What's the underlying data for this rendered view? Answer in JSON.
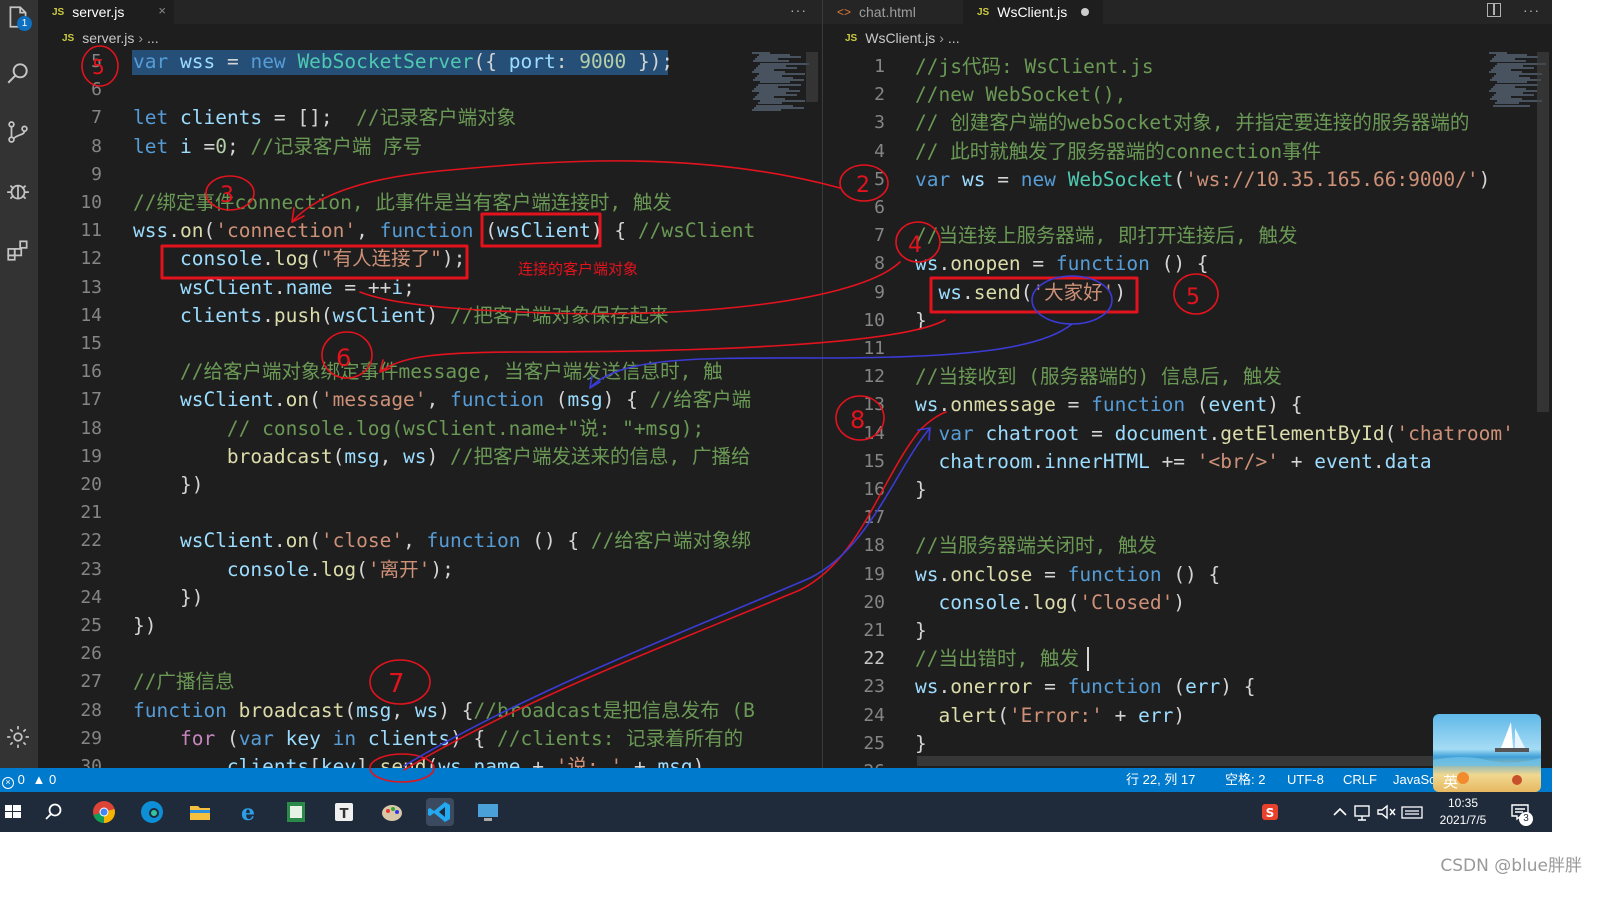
{
  "left_editor": {
    "tab_label": "server.js",
    "tab_close": "×",
    "breadcrumb": [
      "server.js",
      "..."
    ],
    "more": "···",
    "lines": [
      {
        "n": "5",
        "tokens": [
          [
            "k",
            "var"
          ],
          [
            "p",
            " "
          ],
          [
            "v",
            "wss"
          ],
          [
            "p",
            " = "
          ],
          [
            "k",
            "new"
          ],
          [
            "p",
            " "
          ],
          [
            "t",
            "WebSocketServer"
          ],
          [
            "p",
            "({ "
          ],
          [
            "v",
            "port"
          ],
          [
            "p",
            ": "
          ],
          [
            "n",
            "9000"
          ],
          [
            "p",
            " });"
          ]
        ]
      },
      {
        "n": "6",
        "tokens": []
      },
      {
        "n": "7",
        "tokens": [
          [
            "k",
            "let"
          ],
          [
            "p",
            " "
          ],
          [
            "v",
            "clients"
          ],
          [
            "p",
            " = [];  "
          ],
          [
            "c",
            "//记录客户端对象"
          ]
        ]
      },
      {
        "n": "8",
        "tokens": [
          [
            "k",
            "let"
          ],
          [
            "p",
            " "
          ],
          [
            "v",
            "i"
          ],
          [
            "p",
            " ="
          ],
          [
            "n",
            "0"
          ],
          [
            "p",
            "; "
          ],
          [
            "c",
            "//记录客户端 序号"
          ]
        ]
      },
      {
        "n": "9",
        "tokens": []
      },
      {
        "n": "10",
        "tokens": [
          [
            "c",
            "//绑定事件connection, 此事件是当有客户端连接时, 触发"
          ]
        ]
      },
      {
        "n": "11",
        "tokens": [
          [
            "v",
            "wss"
          ],
          [
            "p",
            "."
          ],
          [
            "f",
            "on"
          ],
          [
            "p",
            "("
          ],
          [
            "s",
            "'connection'"
          ],
          [
            "p",
            ", "
          ],
          [
            "k",
            "function"
          ],
          [
            "p",
            " ("
          ],
          [
            "v",
            "wsClient"
          ],
          [
            "p",
            ") { "
          ],
          [
            "c",
            "//wsClient"
          ]
        ]
      },
      {
        "n": "12",
        "tokens": [
          [
            "p",
            "    "
          ],
          [
            "v",
            "console"
          ],
          [
            "p",
            "."
          ],
          [
            "f",
            "log"
          ],
          [
            "p",
            "("
          ],
          [
            "s",
            "\"有人连接了\""
          ],
          [
            "p",
            ");"
          ]
        ]
      },
      {
        "n": "13",
        "tokens": [
          [
            "p",
            "    "
          ],
          [
            "v",
            "wsClient"
          ],
          [
            "p",
            "."
          ],
          [
            "v",
            "name"
          ],
          [
            "p",
            " = ++"
          ],
          [
            "v",
            "i"
          ],
          [
            "p",
            ";"
          ]
        ]
      },
      {
        "n": "14",
        "tokens": [
          [
            "p",
            "    "
          ],
          [
            "v",
            "clients"
          ],
          [
            "p",
            "."
          ],
          [
            "f",
            "push"
          ],
          [
            "p",
            "("
          ],
          [
            "v",
            "wsClient"
          ],
          [
            "p",
            ") "
          ],
          [
            "c",
            "//把客户端对象保存起来"
          ]
        ]
      },
      {
        "n": "15",
        "tokens": []
      },
      {
        "n": "16",
        "tokens": [
          [
            "p",
            "    "
          ],
          [
            "c",
            "//给客户端对象绑定事件message, 当客户端发送信息时, 触"
          ]
        ]
      },
      {
        "n": "17",
        "tokens": [
          [
            "p",
            "    "
          ],
          [
            "v",
            "wsClient"
          ],
          [
            "p",
            "."
          ],
          [
            "f",
            "on"
          ],
          [
            "p",
            "("
          ],
          [
            "s",
            "'message'"
          ],
          [
            "p",
            ", "
          ],
          [
            "k",
            "function"
          ],
          [
            "p",
            " ("
          ],
          [
            "v",
            "msg"
          ],
          [
            "p",
            ") { "
          ],
          [
            "c",
            "//给客户端"
          ]
        ]
      },
      {
        "n": "18",
        "tokens": [
          [
            "p",
            "        "
          ],
          [
            "c",
            "// console.log(wsClient.name+\"说: \"+msg);"
          ]
        ]
      },
      {
        "n": "19",
        "tokens": [
          [
            "p",
            "        "
          ],
          [
            "f",
            "broadcast"
          ],
          [
            "p",
            "("
          ],
          [
            "v",
            "msg"
          ],
          [
            "p",
            ", "
          ],
          [
            "v",
            "ws"
          ],
          [
            "p",
            ") "
          ],
          [
            "c",
            "//把客户端发送来的信息, 广播给"
          ]
        ]
      },
      {
        "n": "20",
        "tokens": [
          [
            "p",
            "    })"
          ]
        ]
      },
      {
        "n": "21",
        "tokens": []
      },
      {
        "n": "22",
        "tokens": [
          [
            "p",
            "    "
          ],
          [
            "v",
            "wsClient"
          ],
          [
            "p",
            "."
          ],
          [
            "f",
            "on"
          ],
          [
            "p",
            "("
          ],
          [
            "s",
            "'close'"
          ],
          [
            "p",
            ", "
          ],
          [
            "k",
            "function"
          ],
          [
            "p",
            " () { "
          ],
          [
            "c",
            "//给客户端对象绑"
          ]
        ]
      },
      {
        "n": "23",
        "tokens": [
          [
            "p",
            "        "
          ],
          [
            "v",
            "console"
          ],
          [
            "p",
            "."
          ],
          [
            "f",
            "log"
          ],
          [
            "p",
            "("
          ],
          [
            "s",
            "'离开'"
          ],
          [
            "p",
            ");"
          ]
        ]
      },
      {
        "n": "24",
        "tokens": [
          [
            "p",
            "    })"
          ]
        ]
      },
      {
        "n": "25",
        "tokens": [
          [
            "p",
            "})"
          ]
        ]
      },
      {
        "n": "26",
        "tokens": []
      },
      {
        "n": "27",
        "tokens": [
          [
            "c",
            "//广播信息"
          ]
        ]
      },
      {
        "n": "28",
        "tokens": [
          [
            "k",
            "function"
          ],
          [
            "p",
            " "
          ],
          [
            "f",
            "broadcast"
          ],
          [
            "p",
            "("
          ],
          [
            "v",
            "msg"
          ],
          [
            "p",
            ", "
          ],
          [
            "v",
            "ws"
          ],
          [
            "p",
            ") {"
          ],
          [
            "c",
            "//broadcast是把信息发布 (B"
          ]
        ]
      },
      {
        "n": "29",
        "tokens": [
          [
            "p",
            "    "
          ],
          [
            "kc",
            "for"
          ],
          [
            "p",
            " ("
          ],
          [
            "k",
            "var"
          ],
          [
            "p",
            " "
          ],
          [
            "v",
            "key"
          ],
          [
            "p",
            " "
          ],
          [
            "k",
            "in"
          ],
          [
            "p",
            " "
          ],
          [
            "v",
            "clients"
          ],
          [
            "p",
            ") { "
          ],
          [
            "c",
            "//clients: 记录着所有的"
          ]
        ]
      },
      {
        "n": "30",
        "tokens": [
          [
            "p",
            "        "
          ],
          [
            "v",
            "clients"
          ],
          [
            "p",
            "["
          ],
          [
            "v",
            "key"
          ],
          [
            "p",
            "]."
          ],
          [
            "f",
            "send"
          ],
          [
            "p",
            "("
          ],
          [
            "v",
            "ws"
          ],
          [
            "p",
            "."
          ],
          [
            "v",
            "name"
          ],
          [
            "p",
            " + "
          ],
          [
            "s",
            "'说: '"
          ],
          [
            "p",
            " + "
          ],
          [
            "v",
            "msg"
          ],
          [
            "p",
            ")"
          ]
        ]
      }
    ]
  },
  "right_editor": {
    "tabs": [
      {
        "label": "chat.html",
        "icon": "<>",
        "active": false
      },
      {
        "label": "WsClient.js",
        "icon": "JS",
        "active": true
      }
    ],
    "breadcrumb": [
      "WsClient.js",
      "..."
    ],
    "more": "···",
    "lines": [
      {
        "n": "1",
        "tokens": [
          [
            "c",
            "//js代码: WsClient.js"
          ]
        ]
      },
      {
        "n": "2",
        "tokens": [
          [
            "c",
            "//new WebSocket(),"
          ]
        ]
      },
      {
        "n": "3",
        "tokens": [
          [
            "c",
            "// 创建客户端的webSocket对象, 并指定要连接的服务器端的"
          ]
        ]
      },
      {
        "n": "4",
        "tokens": [
          [
            "c",
            "// 此时就触发了服务器端的connection事件"
          ]
        ]
      },
      {
        "n": "5",
        "tokens": [
          [
            "k",
            "var"
          ],
          [
            "p",
            " "
          ],
          [
            "v",
            "ws"
          ],
          [
            "p",
            " = "
          ],
          [
            "k",
            "new"
          ],
          [
            "p",
            " "
          ],
          [
            "t",
            "WebSocket"
          ],
          [
            "p",
            "("
          ],
          [
            "s",
            "'ws://10.35.165.66:9000/'"
          ],
          [
            "p",
            ")"
          ]
        ]
      },
      {
        "n": "6",
        "tokens": []
      },
      {
        "n": "7",
        "tokens": [
          [
            "c",
            "//当连接上服务器端, 即打开连接后, 触发"
          ]
        ]
      },
      {
        "n": "8",
        "tokens": [
          [
            "v",
            "ws"
          ],
          [
            "p",
            "."
          ],
          [
            "f",
            "onopen"
          ],
          [
            "p",
            " = "
          ],
          [
            "k",
            "function"
          ],
          [
            "p",
            " () {"
          ]
        ]
      },
      {
        "n": "9",
        "tokens": [
          [
            "p",
            "  "
          ],
          [
            "v",
            "ws"
          ],
          [
            "p",
            "."
          ],
          [
            "f",
            "send"
          ],
          [
            "p",
            "("
          ],
          [
            "s",
            "'大家好'"
          ],
          [
            "p",
            ")"
          ]
        ]
      },
      {
        "n": "10",
        "tokens": [
          [
            "p",
            "}"
          ]
        ]
      },
      {
        "n": "11",
        "tokens": []
      },
      {
        "n": "12",
        "tokens": [
          [
            "c",
            "//当接收到 (服务器端的) 信息后, 触发"
          ]
        ]
      },
      {
        "n": "13",
        "tokens": [
          [
            "v",
            "ws"
          ],
          [
            "p",
            "."
          ],
          [
            "f",
            "onmessage"
          ],
          [
            "p",
            " = "
          ],
          [
            "k",
            "function"
          ],
          [
            "p",
            " ("
          ],
          [
            "v",
            "event"
          ],
          [
            "p",
            ") {"
          ]
        ]
      },
      {
        "n": "14",
        "tokens": [
          [
            "p",
            "  "
          ],
          [
            "k",
            "var"
          ],
          [
            "p",
            " "
          ],
          [
            "v",
            "chatroot"
          ],
          [
            "p",
            " = "
          ],
          [
            "v",
            "document"
          ],
          [
            "p",
            "."
          ],
          [
            "f",
            "getElementById"
          ],
          [
            "p",
            "("
          ],
          [
            "s",
            "'chatroom'"
          ]
        ]
      },
      {
        "n": "15",
        "tokens": [
          [
            "p",
            "  "
          ],
          [
            "v",
            "chatroom"
          ],
          [
            "p",
            "."
          ],
          [
            "v",
            "innerHTML"
          ],
          [
            "p",
            " += "
          ],
          [
            "s",
            "'<br/>'"
          ],
          [
            "p",
            " + "
          ],
          [
            "v",
            "event"
          ],
          [
            "p",
            "."
          ],
          [
            "v",
            "data"
          ]
        ]
      },
      {
        "n": "16",
        "tokens": [
          [
            "p",
            "}"
          ]
        ]
      },
      {
        "n": "17",
        "tokens": []
      },
      {
        "n": "18",
        "tokens": [
          [
            "c",
            "//当服务器端关闭时, 触发"
          ]
        ]
      },
      {
        "n": "19",
        "tokens": [
          [
            "v",
            "ws"
          ],
          [
            "p",
            "."
          ],
          [
            "f",
            "onclose"
          ],
          [
            "p",
            " = "
          ],
          [
            "k",
            "function"
          ],
          [
            "p",
            " () {"
          ]
        ]
      },
      {
        "n": "20",
        "tokens": [
          [
            "p",
            "  "
          ],
          [
            "v",
            "console"
          ],
          [
            "p",
            "."
          ],
          [
            "f",
            "log"
          ],
          [
            "p",
            "("
          ],
          [
            "s",
            "'Closed'"
          ],
          [
            "p",
            ")"
          ]
        ]
      },
      {
        "n": "21",
        "tokens": [
          [
            "p",
            "}"
          ]
        ]
      },
      {
        "n": "22",
        "tokens": [
          [
            "c",
            "//当出错时, 触发"
          ]
        ]
      },
      {
        "n": "23",
        "tokens": [
          [
            "v",
            "ws"
          ],
          [
            "p",
            "."
          ],
          [
            "f",
            "onerror"
          ],
          [
            "p",
            " = "
          ],
          [
            "k",
            "function"
          ],
          [
            "p",
            " ("
          ],
          [
            "v",
            "err"
          ],
          [
            "p",
            ") {"
          ]
        ]
      },
      {
        "n": "24",
        "tokens": [
          [
            "p",
            "  "
          ],
          [
            "f",
            "alert"
          ],
          [
            "p",
            "("
          ],
          [
            "s",
            "'Error:'"
          ],
          [
            "p",
            " + "
          ],
          [
            "v",
            "err"
          ],
          [
            "p",
            ")"
          ]
        ]
      },
      {
        "n": "25",
        "tokens": [
          [
            "p",
            "}"
          ]
        ]
      },
      {
        "n": "26",
        "tokens": []
      }
    ]
  },
  "annotations": {
    "label_text": "连接的客户端对象",
    "numbers": [
      "5",
      "2",
      "3",
      "4",
      "5",
      "6",
      "7",
      "8"
    ]
  },
  "status_bar": {
    "errors": "0",
    "warnings": "0",
    "position": "行 22, 列 17",
    "spaces": "空格: 2",
    "encoding": "UTF-8",
    "eol": "CRLF",
    "language": "JavaSc"
  },
  "ime": {
    "label": "英"
  },
  "taskbar": {
    "time": "10:35",
    "date": "2021/7/5",
    "notifications": "3"
  },
  "watermark": "CSDN @blue胖胖",
  "colors": {
    "editor_bg": "#1e1e1e",
    "statusbar": "#007acc",
    "annotation_red": "#e3131e",
    "annotation_blue": "#3b3bd6"
  }
}
